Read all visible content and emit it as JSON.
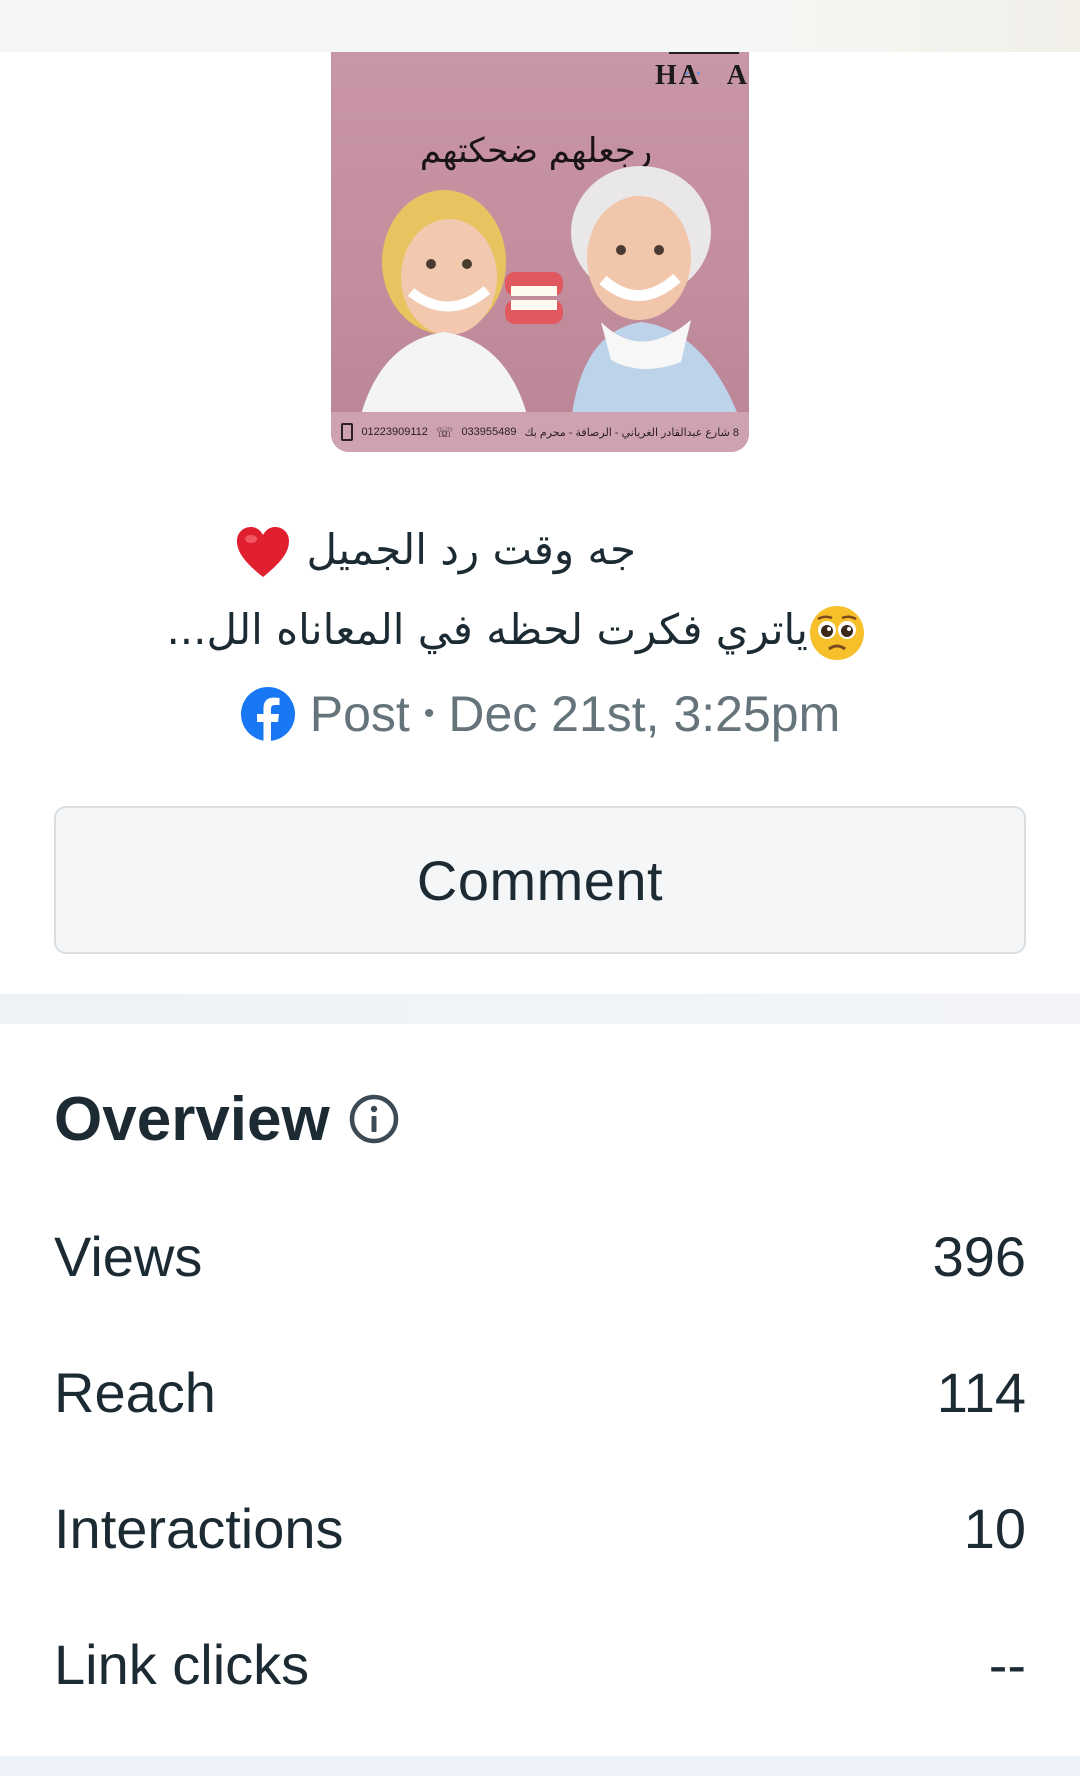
{
  "post": {
    "image": {
      "logo_left": "HA",
      "logo_right": "A",
      "logo_dots": "• •",
      "tagline": "رجعلهم ضحكتهم",
      "footer_mobile": "01223909112",
      "footer_phone": "033955489",
      "footer_address": "8 شارع عبدالقادر الغرياني - الرصافة - محرم بك"
    },
    "caption_line1": "جه وقت رد الجميل",
    "caption_line2": "ياتري فكرت لحظه في المعاناه الل...",
    "type_label": "Post",
    "separator": "•",
    "date": "Dec 21st, 3:25pm"
  },
  "comment_button_label": "Comment",
  "overview": {
    "title": "Overview",
    "metrics": [
      {
        "label": "Views",
        "value": "396"
      },
      {
        "label": "Reach",
        "value": "114"
      },
      {
        "label": "Interactions",
        "value": "10"
      },
      {
        "label": "Link clicks",
        "value": "--"
      }
    ]
  },
  "colors": {
    "facebook_blue": "#1877f2",
    "text_primary": "#1c2b33",
    "text_secondary": "#65737a",
    "heart_red": "#e0202e",
    "image_background": "#c996a6"
  },
  "icons": [
    "facebook-icon",
    "info-icon",
    "heart-emoji",
    "pleading-face-emoji",
    "mobile-phone-icon",
    "telephone-icon"
  ]
}
